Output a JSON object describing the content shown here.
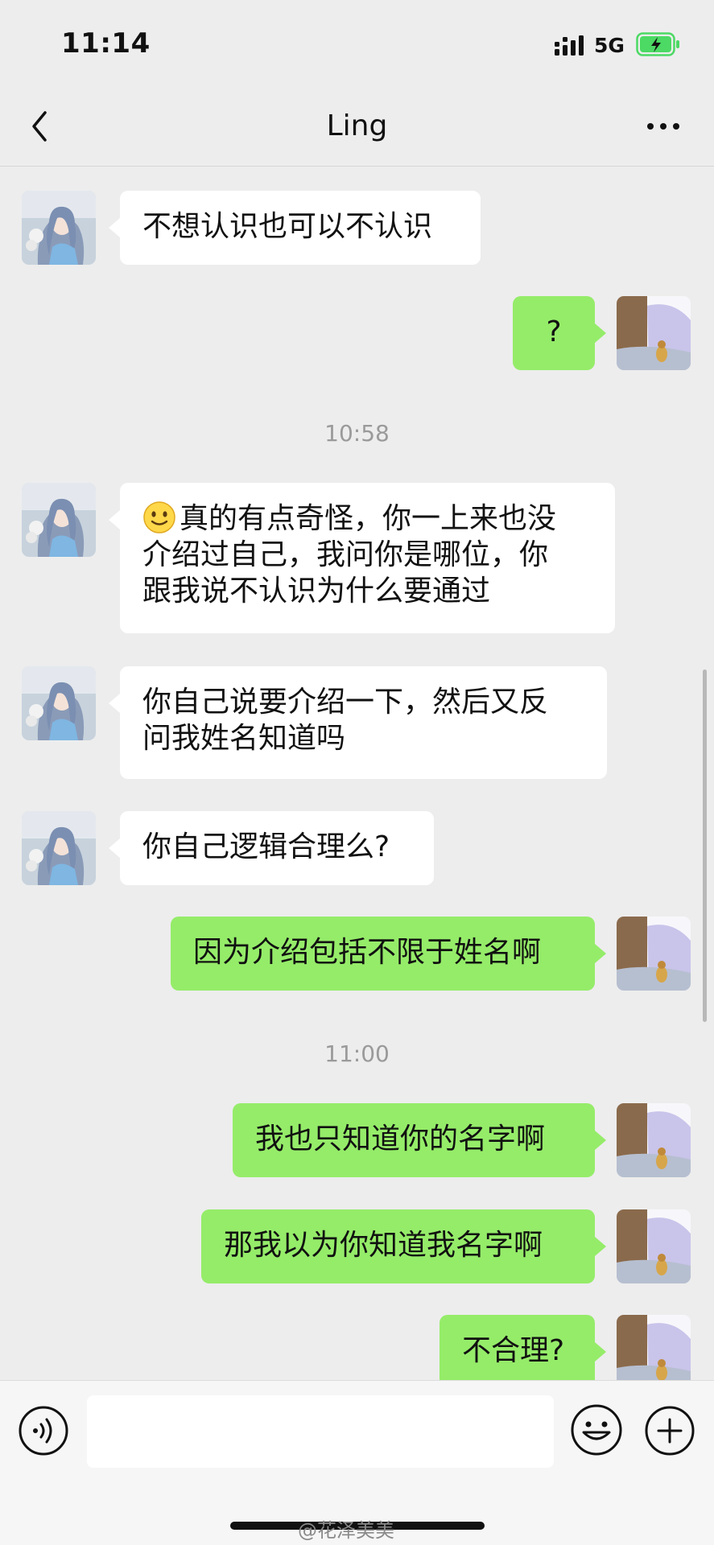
{
  "status_bar": {
    "time": "11:14",
    "network": "5G"
  },
  "nav": {
    "title": "Ling"
  },
  "messages": [
    {
      "side": "in",
      "text": "不想认识也可以不认识"
    },
    {
      "side": "out",
      "text": "?"
    },
    {
      "time": "10:58"
    },
    {
      "side": "in",
      "emoji": "smile-emoji",
      "lines": [
        "真的有点奇怪，你一上来也没",
        "介绍过自己，我问你是哪位，你",
        "跟我说不认识为什么要通过"
      ]
    },
    {
      "side": "in",
      "lines": [
        "你自己说要介绍一下，然后又反",
        "问我姓名知道吗"
      ]
    },
    {
      "side": "in",
      "text": "你自己逻辑合理么?"
    },
    {
      "side": "out",
      "text": "因为介绍包括不限于姓名啊"
    },
    {
      "time": "11:00"
    },
    {
      "side": "out",
      "text": "我也只知道你的名字啊"
    },
    {
      "side": "out",
      "text": "那我以为你知道我名字啊"
    },
    {
      "side": "out",
      "text": "不合理?"
    }
  ],
  "input_bar": {
    "placeholder": ""
  },
  "watermark": "@花泽美美",
  "colors": {
    "background": "#ededed",
    "outgoing_bubble": "#95ec69",
    "incoming_bubble": "#ffffff",
    "battery": "#4cd964"
  }
}
